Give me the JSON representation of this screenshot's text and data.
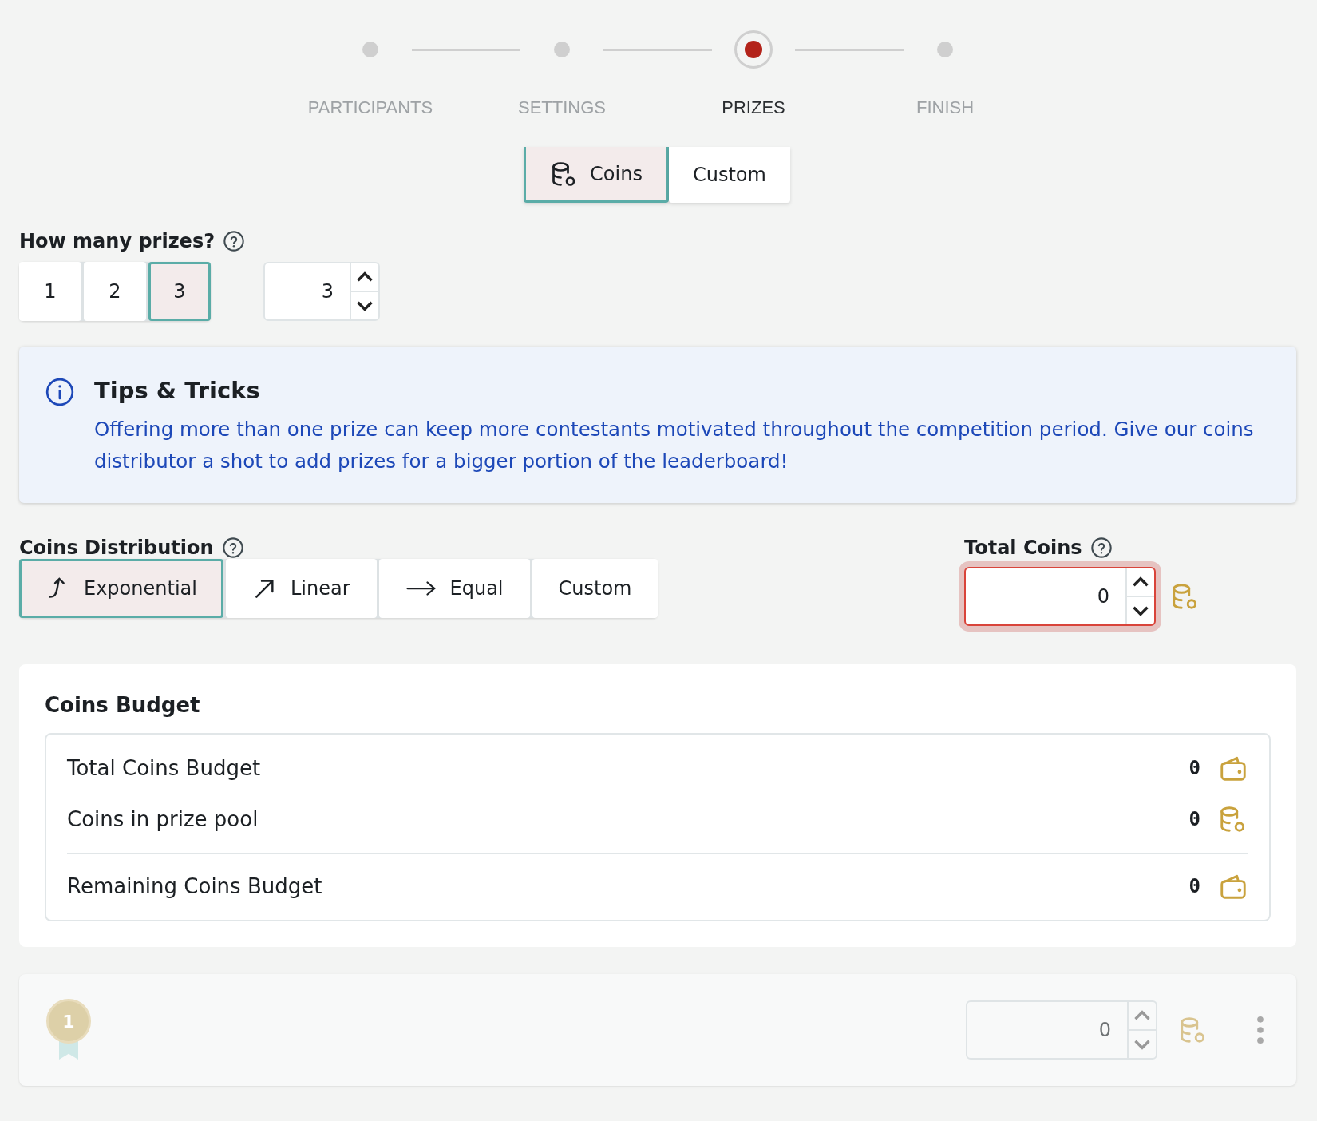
{
  "steps": [
    {
      "label": "PARTICIPANTS",
      "selected": false
    },
    {
      "label": "SETTINGS",
      "selected": false
    },
    {
      "label": "PRIZES",
      "selected": true
    },
    {
      "label": "FINISH",
      "selected": false
    }
  ],
  "prize_type_tabs": [
    {
      "label": "Coins",
      "kind": "coins",
      "selected": true
    },
    {
      "label": "Custom",
      "kind": "plain",
      "selected": false
    }
  ],
  "prize_count": {
    "label": "How many prizes?",
    "options": [
      {
        "label": "1",
        "selected": false
      },
      {
        "label": "2",
        "selected": false
      },
      {
        "label": "3",
        "selected": true
      }
    ],
    "value": "3"
  },
  "tips": {
    "title": "Tips & Tricks",
    "text": "Offering more than one prize can keep more contestants motivated throughout the competition period. Give our coins distributor a shot to add prizes for a bigger portion of the leaderboard!"
  },
  "distribution": {
    "label": "Coins Distribution",
    "options": [
      {
        "label": "Exponential",
        "kind": "exponential",
        "selected": true
      },
      {
        "label": "Linear",
        "kind": "linear",
        "selected": false
      },
      {
        "label": "Equal",
        "kind": "equal",
        "selected": false
      },
      {
        "label": "Custom",
        "kind": "plain",
        "selected": false
      }
    ]
  },
  "total_coins": {
    "label": "Total Coins",
    "value": "0",
    "invalid": true
  },
  "budget": {
    "title": "Coins Budget",
    "groups": [
      [
        {
          "label": "Total Coins Budget",
          "value": "0",
          "kind": "wallet"
        },
        {
          "label": "Coins in prize pool",
          "value": "0",
          "kind": "coins"
        }
      ],
      [
        {
          "label": "Remaining Coins Budget",
          "value": "0",
          "kind": "wallet"
        }
      ]
    ]
  },
  "prizes": [
    {
      "rank": "1",
      "value": "0",
      "disabled": true
    }
  ]
}
